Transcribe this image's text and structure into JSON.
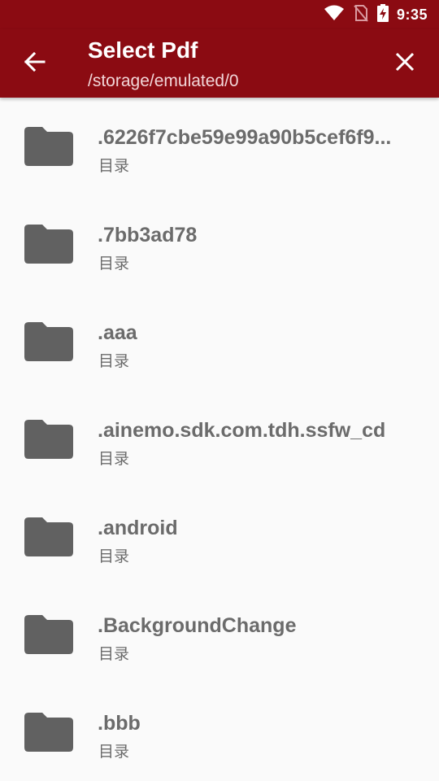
{
  "status_bar": {
    "time": "9:35"
  },
  "app_bar": {
    "title": "Select Pdf",
    "path": "/storage/emulated/0"
  },
  "files": [
    {
      "name": ".6226f7cbe59e99a90b5cef6f9...",
      "type": "目录"
    },
    {
      "name": ".7bb3ad78",
      "type": "目录"
    },
    {
      "name": ".aaa",
      "type": "目录"
    },
    {
      "name": ".ainemo.sdk.com.tdh.ssfw_cd",
      "type": "目录"
    },
    {
      "name": ".android",
      "type": "目录"
    },
    {
      "name": ".BackgroundChange",
      "type": "目录"
    },
    {
      "name": ".bbb",
      "type": "目录"
    }
  ],
  "colors": {
    "primary": "#8b0b12",
    "folder": "#616161",
    "text": "#6b6b6b",
    "background": "#fafafa"
  },
  "icons": [
    "wifi-icon",
    "no-sim-icon",
    "battery-charging-icon",
    "back-arrow-icon",
    "close-icon",
    "folder-icon"
  ]
}
